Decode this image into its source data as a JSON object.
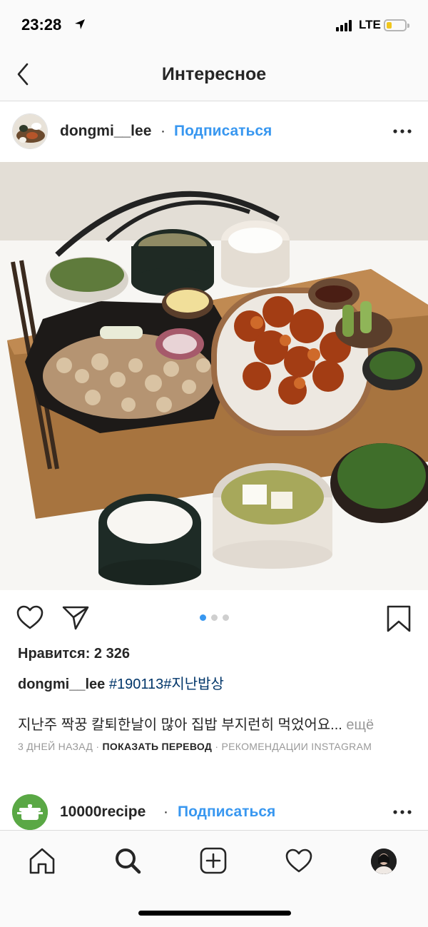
{
  "status": {
    "time": "23:28",
    "network": "LTE"
  },
  "header": {
    "title": "Интересное"
  },
  "post": {
    "username": "dongmi__lee",
    "separator": "·",
    "follow_label": "Подписаться",
    "carousel": {
      "count": 3,
      "active": 1
    },
    "likes_label": "Нравится:",
    "likes_count": "2 326",
    "caption_user": "dongmi__lee",
    "caption_tags": "#190113#지난밥상",
    "comment_text": "지난주 짝꿍 칼퇴한날이 많아 집밥 부지런히 먹었어요...",
    "comment_more": " ещё",
    "meta_time": "3 ДНЕЙ НАЗАД",
    "meta_sep": " · ",
    "meta_translate": "ПОКАЗАТЬ ПЕРЕВОД",
    "meta_recommend": " · РЕКОМЕНДАЦИИ INSTAGRAM"
  },
  "post2": {
    "username": "10000recipe",
    "separator": "·",
    "follow_label": "Подписаться"
  },
  "tabbar": {
    "items": [
      "home-icon",
      "search-icon",
      "add-post-icon",
      "activity-heart-icon",
      "profile-avatar"
    ]
  },
  "colors": {
    "accent": "#3897f0",
    "hashtag": "#003569",
    "muted": "#999999"
  }
}
